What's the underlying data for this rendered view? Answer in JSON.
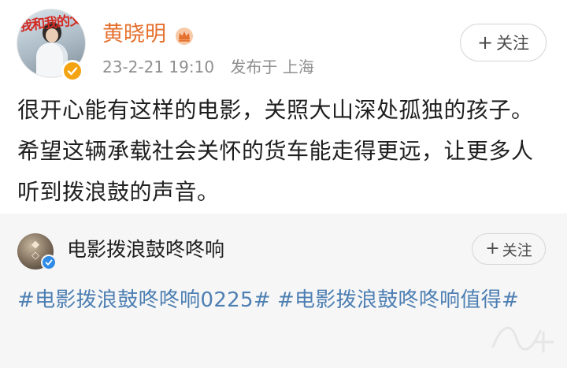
{
  "post": {
    "author": {
      "name": "黄晓明",
      "avatar_text": "我和我的父辈",
      "verified_badge": "orange-verified",
      "member_icon": "crown-icon"
    },
    "meta": {
      "timestamp": "23-2-21 19:10",
      "location": "发布于 上海"
    },
    "follow_button": {
      "plus": "+",
      "label": "关注"
    },
    "text": "很开心能有这样的电影，关照大山深处孤独的孩子。希望这辆承载社会关怀的货车能走得更远，让更多人听到拨浪鼓的声音。"
  },
  "repost": {
    "author": {
      "name": "电影拨浪鼓咚咚响",
      "verified_badge": "blue-verified"
    },
    "follow_button": {
      "plus": "+",
      "label": "关注"
    },
    "hashtags": [
      "#电影拨浪鼓咚咚响0225#",
      "#电影拨浪鼓咚咚响值得#"
    ]
  },
  "colors": {
    "username": "#e5712f",
    "hashtag": "#4d7fb3",
    "meta": "#8f8f8f",
    "card_background": "#f6f6f6"
  }
}
